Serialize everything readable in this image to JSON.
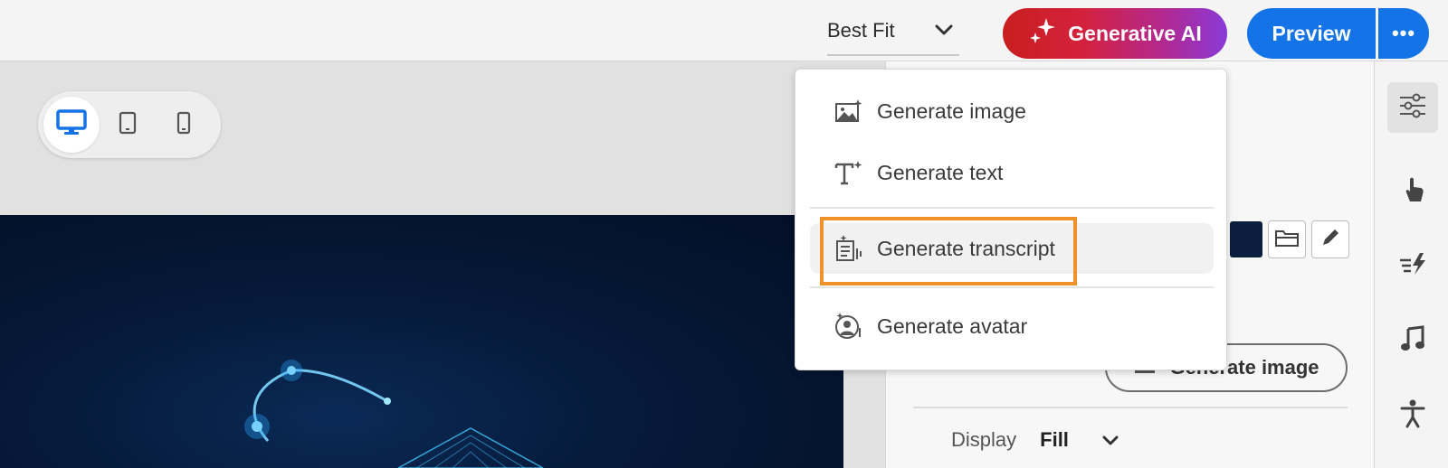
{
  "toolbar": {
    "fit_select_value": "Best Fit",
    "generative_ai_label": "Generative AI",
    "preview_label": "Preview",
    "more_label": "•••"
  },
  "generative_menu": {
    "items": [
      {
        "label": "Generate image",
        "icon": "image-sparkle-icon"
      },
      {
        "label": "Generate text",
        "icon": "text-sparkle-icon"
      },
      {
        "label": "Generate transcript",
        "icon": "transcript-sparkle-icon",
        "highlighted": true
      },
      {
        "label": "Generate avatar",
        "icon": "avatar-sparkle-icon"
      }
    ]
  },
  "device_toggle": {
    "options": [
      "desktop-icon",
      "tablet-icon",
      "mobile-icon"
    ],
    "selected": "desktop-icon"
  },
  "properties_panel": {
    "generate_image_label": "Generate image",
    "display_label": "Display",
    "display_value": "Fill"
  },
  "right_rail": {
    "icons": [
      "sliders-icon",
      "touch-icon",
      "lightning-icon",
      "music-icon",
      "accessibility-icon"
    ]
  },
  "colors": {
    "accent_blue": "#1473e6",
    "highlight_orange": "#f0912a",
    "gen_ai_gradient_start": "#c81e1e",
    "gen_ai_gradient_end": "#8a3ad8"
  }
}
